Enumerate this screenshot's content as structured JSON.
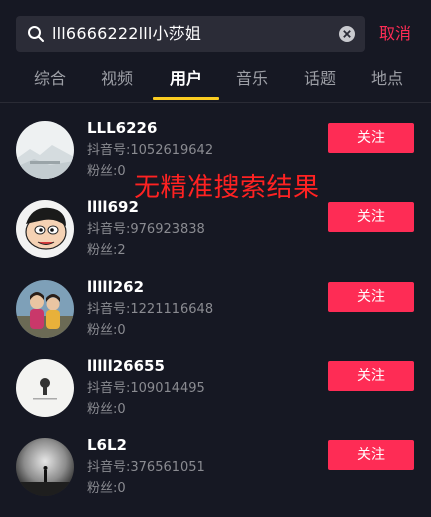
{
  "search": {
    "query": "lll6666222lll小莎姐",
    "cancel_label": "取消"
  },
  "tabs": [
    {
      "label": "综合"
    },
    {
      "label": "视频"
    },
    {
      "label": "用户",
      "active": true
    },
    {
      "label": "音乐"
    },
    {
      "label": "话题"
    },
    {
      "label": "地点"
    }
  ],
  "users": [
    {
      "name": "LLL6226",
      "id_text": "抖音号:1052619642",
      "fans_text": "粉丝:0",
      "follow_label": "关注"
    },
    {
      "name": "llll692",
      "id_text": "抖音号:976923838",
      "fans_text": "粉丝:2",
      "follow_label": "关注"
    },
    {
      "name": "lllll262",
      "id_text": "抖音号:1221116648",
      "fans_text": "粉丝:0",
      "follow_label": "关注"
    },
    {
      "name": "lllll26655",
      "id_text": "抖音号:109014495",
      "fans_text": "粉丝:0",
      "follow_label": "关注"
    },
    {
      "name": "L6L2",
      "id_text": "抖音号:376561051",
      "fans_text": "粉丝:0",
      "follow_label": "关注"
    }
  ],
  "overlay": {
    "text": "无精准搜索结果"
  },
  "colors": {
    "accent": "#fe2c55",
    "tab_indicator": "#facc21",
    "background": "#161823",
    "overlay": "#ff2222"
  }
}
